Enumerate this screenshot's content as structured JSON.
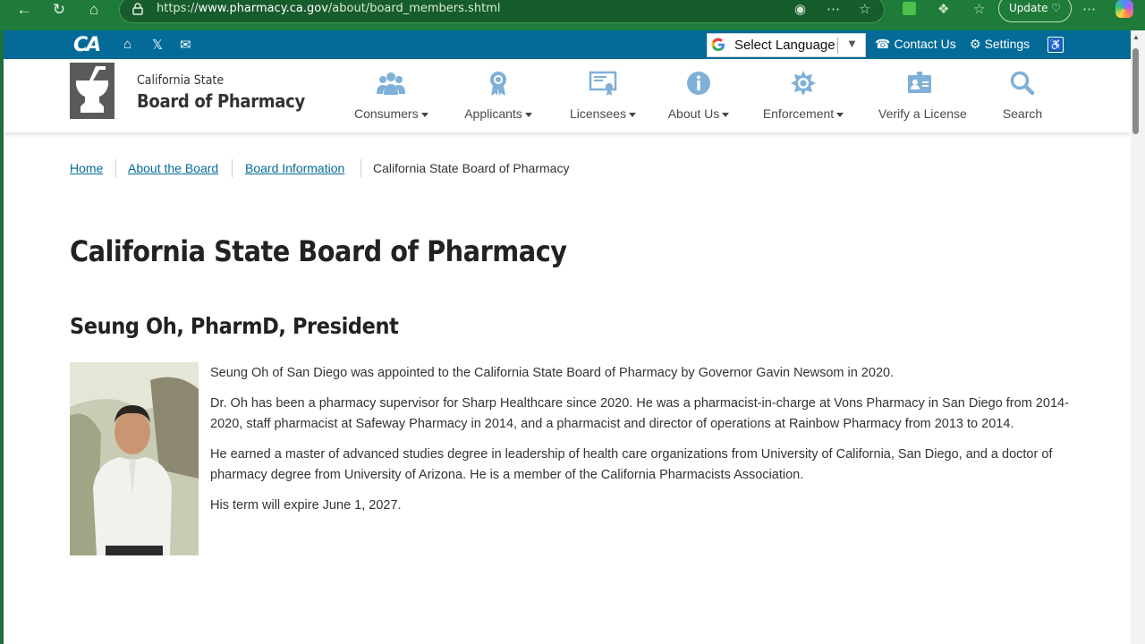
{
  "browser": {
    "url_prefix": "https://",
    "url_domain": "www.pharmacy.ca.gov",
    "url_path": "/about/board_members.shtml",
    "update_label": "Update"
  },
  "utility": {
    "language_label": "Select Language",
    "contact_label": "Contact Us",
    "settings_label": "Settings"
  },
  "header": {
    "org_line1": "California State",
    "org_line2": "Board of Pharmacy",
    "nav": [
      {
        "label": "Consumers",
        "icon": "people-icon",
        "dropdown": true
      },
      {
        "label": "Applicants",
        "icon": "award-ribbon-icon",
        "dropdown": true
      },
      {
        "label": "Licensees",
        "icon": "certificate-icon",
        "dropdown": true
      },
      {
        "label": "About Us",
        "icon": "info-icon",
        "dropdown": true
      },
      {
        "label": "Enforcement",
        "icon": "badge-icon",
        "dropdown": true
      },
      {
        "label": "Verify a License",
        "icon": "id-card-icon",
        "dropdown": false
      },
      {
        "label": "Search",
        "icon": "search-icon",
        "dropdown": false
      }
    ]
  },
  "breadcrumb": {
    "items": [
      "Home",
      "About the Board",
      "Board Information"
    ],
    "current": "California State Board of Pharmacy"
  },
  "main": {
    "title": "California State Board of Pharmacy",
    "member_name": "Seung Oh, PharmD, President",
    "bio": [
      "Seung Oh of San Diego was appointed to the California State Board of Pharmacy by Governor Gavin Newsom in 2020.",
      "Dr. Oh has been a pharmacy supervisor for Sharp Healthcare since 2020. He was a pharmacist-in-charge at Vons Pharmacy in San Diego from 2014-2020, staff pharmacist at Safeway Pharmacy in 2014, and a pharmacist and director of operations at Rainbow Pharmacy from 2013 to 2014.",
      "He earned a master of advanced studies degree in leadership of health care organizations from University of California, San Diego, and a doctor of pharmacy degree from University of Arizona. He is a member of the California Pharmacists Association.",
      "His term will expire June 1, 2027."
    ]
  },
  "colors": {
    "browser_chrome": "#1e7b3a",
    "utility_bar": "#046b99",
    "link": "#046b99",
    "nav_icon": "#7fb0d8"
  }
}
